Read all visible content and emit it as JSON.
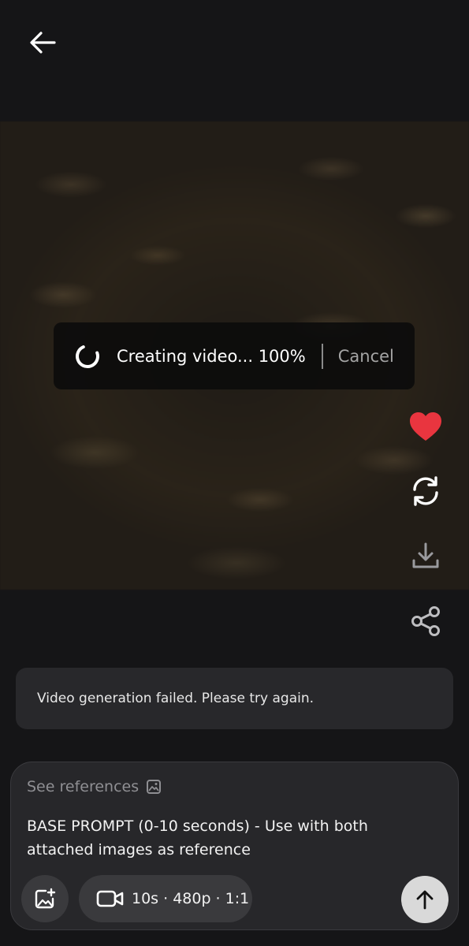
{
  "header": {
    "back_icon": "arrow-left-icon"
  },
  "video": {
    "status_text": "Creating video... 100%",
    "progress_percent": 100,
    "cancel_label": "Cancel"
  },
  "actions": {
    "like_icon": "heart-icon",
    "like_color": "#e9353f",
    "regenerate_icon": "refresh-icon",
    "download_icon": "download-icon",
    "share_icon": "share-icon"
  },
  "error": {
    "message": "Video generation failed. Please try again."
  },
  "composer": {
    "see_references_label": "See references",
    "prompt": "BASE PROMPT (0-10 seconds) - Use with both attached images as reference",
    "settings_label": "10s · 480p · 1:1",
    "send_icon": "arrow-up-icon"
  }
}
